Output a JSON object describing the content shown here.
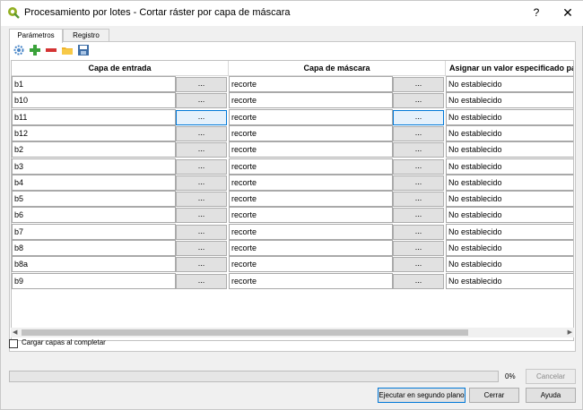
{
  "window": {
    "title": "Procesamiento por lotes - Cortar ráster por capa de máscara",
    "help_button": "?",
    "close_button": "✕"
  },
  "tabs": [
    {
      "label": "Parámetros"
    },
    {
      "label": "Registro"
    }
  ],
  "toolbar": {
    "icons": [
      "gear-icon",
      "add-icon",
      "remove-icon",
      "open-folder-icon",
      "save-icon"
    ]
  },
  "table": {
    "columns": [
      "Capa de entrada",
      "Capa de máscara",
      "Asignar un valor especificado para valores sin datos de salida"
    ],
    "ellipsis": "...",
    "rows": [
      {
        "input": "b1",
        "mask": "recorte",
        "nodata": "No establecido"
      },
      {
        "input": "b10",
        "mask": "recorte",
        "nodata": "No establecido"
      },
      {
        "input": "b11",
        "mask": "recorte",
        "nodata": "No establecido"
      },
      {
        "input": "b12",
        "mask": "recorte",
        "nodata": "No establecido"
      },
      {
        "input": "b2",
        "mask": "recorte",
        "nodata": "No establecido"
      },
      {
        "input": "b3",
        "mask": "recorte",
        "nodata": "No establecido"
      },
      {
        "input": "b4",
        "mask": "recorte",
        "nodata": "No establecido"
      },
      {
        "input": "b5",
        "mask": "recorte",
        "nodata": "No establecido"
      },
      {
        "input": "b6",
        "mask": "recorte",
        "nodata": "No establecido"
      },
      {
        "input": "b7",
        "mask": "recorte",
        "nodata": "No establecido"
      },
      {
        "input": "b8",
        "mask": "recorte",
        "nodata": "No establecido"
      },
      {
        "input": "b8a",
        "mask": "recorte",
        "nodata": "No establecido"
      },
      {
        "input": "b9",
        "mask": "recorte",
        "nodata": "No establecido"
      }
    ]
  },
  "options": {
    "load_layers_label": "Cargar capas al completar",
    "load_layers_checked": false
  },
  "progress": {
    "value": 0,
    "label": "0%"
  },
  "buttons": {
    "cancel": "Cancelar",
    "run_background": "Ejecutar en segundo plano",
    "close": "Cerrar",
    "help": "Ayuda"
  }
}
